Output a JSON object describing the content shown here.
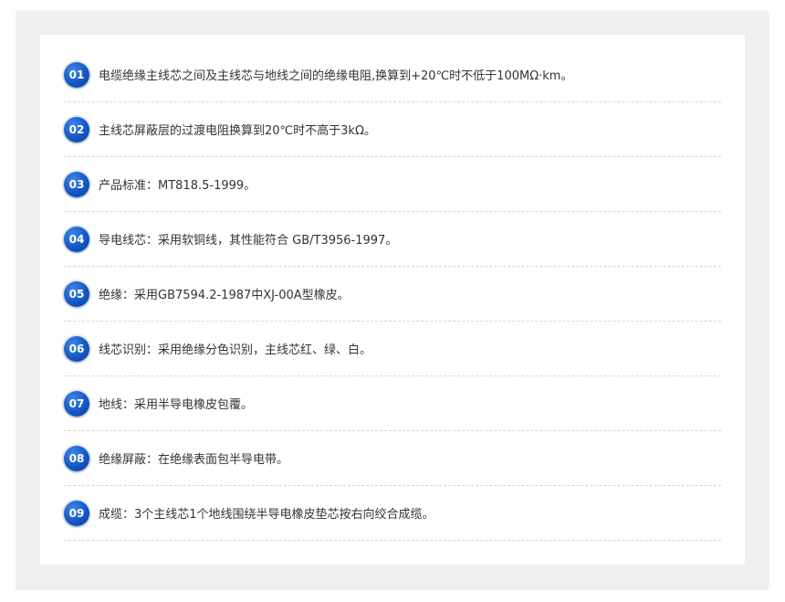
{
  "items": [
    {
      "num": "01",
      "text": "电缆绝缘主线芯之间及主线芯与地线之间的绝缘电阻,换算到+20℃时不低于100MΩ·km。"
    },
    {
      "num": "02",
      "text": "主线芯屏蔽层的过渡电阻换算到20℃时不高于3kΩ。"
    },
    {
      "num": "03",
      "text": "产品标准：MT818.5-1999。"
    },
    {
      "num": "04",
      "text": "导电线芯：采用软铜线，其性能符合 GB/T3956-1997。"
    },
    {
      "num": "05",
      "text": "绝缘：采用GB7594.2-1987中XJ-00A型橡皮。"
    },
    {
      "num": "06",
      "text": "线芯识别：采用绝缘分色识别，主线芯红、绿、白。"
    },
    {
      "num": "07",
      "text": "地线：采用半导电橡皮包覆。"
    },
    {
      "num": "08",
      "text": "绝缘屏蔽：在绝缘表面包半导电带。"
    },
    {
      "num": "09",
      "text": "成缆：3个主线芯1个地线围绕半导电橡皮垫芯按右向绞合成缆。"
    }
  ],
  "colors": {
    "badge": "#1457c5",
    "text": "#333333",
    "divider": "#d6d6d6",
    "background": "#efefef"
  }
}
